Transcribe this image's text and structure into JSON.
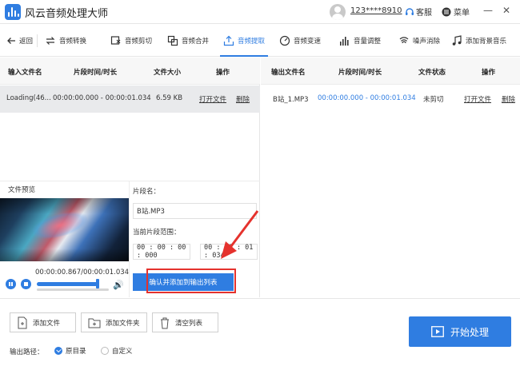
{
  "window": {
    "title": "风云音频处理大师",
    "account": "123****8910",
    "support_label": "客服",
    "menu_label": "菜单",
    "minimize": "—",
    "close": "✕"
  },
  "toolbar": {
    "back": "返回",
    "items": [
      {
        "label": "音频转换",
        "icon": "convert-icon"
      },
      {
        "label": "音频剪切",
        "icon": "cut-icon"
      },
      {
        "label": "音频合并",
        "icon": "merge-icon"
      },
      {
        "label": "音频提取",
        "icon": "extract-icon",
        "active": true
      },
      {
        "label": "音频变速",
        "icon": "speed-icon"
      },
      {
        "label": "音量调整",
        "icon": "volume-bars-icon"
      },
      {
        "label": "噪声消除",
        "icon": "noise-icon"
      },
      {
        "label": "添加背景音乐",
        "icon": "music-icon"
      }
    ],
    "accent": "#2f7de1"
  },
  "input_table": {
    "headers": [
      "输入文件名",
      "片段时间/时长",
      "文件大小",
      "操作"
    ],
    "rows": [
      {
        "name": "Loading(46...",
        "range": "00:00:00.000 - 00:00:01.034",
        "size": "6.59 KB",
        "open": "打开文件",
        "delete": "删除"
      }
    ]
  },
  "output_table": {
    "headers": [
      "输出文件名",
      "片段时间/时长",
      "文件状态",
      "操作"
    ],
    "rows": [
      {
        "name": "B站_1.MP3",
        "range": "00:00:00.000 - 00:00:01.034",
        "status": "未剪切",
        "open": "打开文件",
        "delete": "删除"
      }
    ]
  },
  "preview": {
    "label": "文件预览",
    "time": "00:00:00.867/00:00:01.034",
    "progress": 0.84
  },
  "segment": {
    "name_label": "片段名：",
    "name_value": "B站.MP3",
    "range_label": "当前片段范围：",
    "start": "00 : 00 : 00 : 000",
    "end": "00 : 00 : 01 : 034",
    "confirm": "确认并添加到输出列表"
  },
  "footer": {
    "add_file": "添加文件",
    "add_folder": "添加文件夹",
    "clear_list": "清空列表",
    "start": "开始处理",
    "output_path_label": "输出路径：",
    "option_original": "原目录",
    "option_custom": "自定义"
  }
}
